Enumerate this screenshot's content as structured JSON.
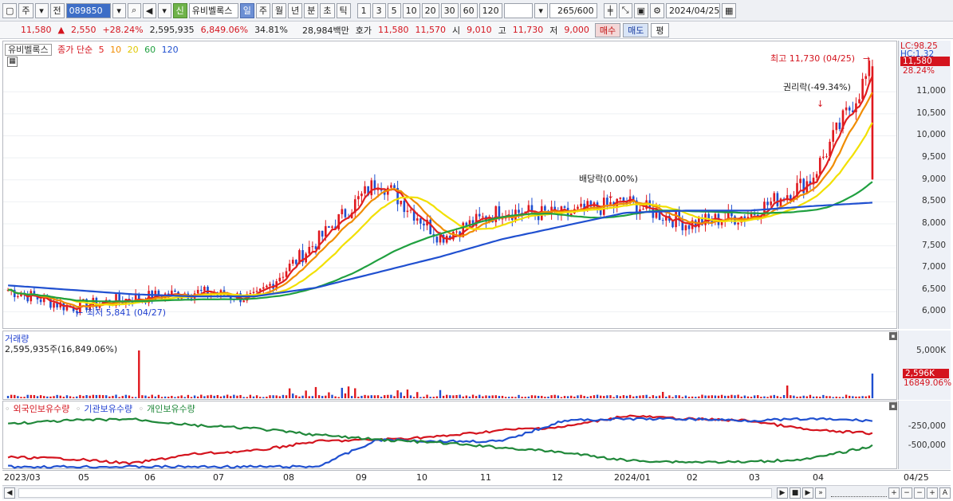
{
  "toolbar": {
    "type_label": "주",
    "prev_label": "전",
    "code_value": "089850",
    "stock_name": "유비벨록스",
    "credit_badge": "신",
    "periods": [
      "일",
      "주",
      "월",
      "년",
      "분",
      "초",
      "틱"
    ],
    "minute_options": [
      "1",
      "3",
      "5",
      "10",
      "20",
      "30",
      "60",
      "120"
    ],
    "count_value": "265",
    "count_total": "/600",
    "date_value": "2024/04/25"
  },
  "quote": {
    "price": "11,580",
    "change_arrow": "▲",
    "change": "2,550",
    "change_pct": "+28.24%",
    "volume": "2,595,935",
    "volume_ratio": "6,849.06%",
    "turnover": "34.81%",
    "trade_amount": "28,984백만",
    "ask_label": "호가",
    "ask_price": "11,580",
    "bid_price": "11,570",
    "open_label": "시",
    "open": "9,010",
    "high_label": "고",
    "high": "11,730",
    "low_label": "저",
    "low": "9,000",
    "buy_label": "매수",
    "sell_label": "매도",
    "eval_label": "평"
  },
  "price_panel": {
    "legend_name": "유비벨록스",
    "legend_ma": "종가 단순",
    "ma_periods": [
      "5",
      "10",
      "20",
      "60",
      "120"
    ],
    "ma_colors": [
      "#e02020",
      "#f08c00",
      "#f2e000",
      "#20a040",
      "#2050d0"
    ],
    "high_note": "최고 11,730 (04/25)",
    "low_note": "최저 5,841 (04/27)",
    "rights_note": "권리락(-49.34%)",
    "dividend_note": "배당락(0.00%)",
    "lc_label": "LC:98.25",
    "hc_label": "HC:1.32",
    "current_tag": "11,580",
    "current_pct": "28.24%",
    "y_ticks": [
      "11,000",
      "10,500",
      "10,000",
      "9,500",
      "9,000",
      "8,500",
      "8,000",
      "7,500",
      "7,000",
      "6,500",
      "6,000"
    ]
  },
  "volume_panel": {
    "title": "거래량",
    "summary": "2,595,935주(16,849.06%)",
    "y_tick": "5,000K",
    "current_tag": "2,596K",
    "current_pct": "16849.06%"
  },
  "holding_panel": {
    "legend_foreign": "외국인보유수량",
    "legend_inst": "기관보유수량",
    "legend_indiv": "개인보유수량",
    "y_ticks": [
      "-250,000",
      "-500,000"
    ]
  },
  "x_axis": {
    "labels": [
      "2023/03",
      "05",
      "06",
      "07",
      "08",
      "09",
      "10",
      "11",
      "12",
      "2024/01",
      "02",
      "03",
      "04"
    ],
    "right_label": "04/25"
  },
  "chart_data": {
    "type": "candlestick",
    "title": "유비벨록스",
    "x": [
      "2023/03",
      "2023/04",
      "2023/05",
      "2023/06",
      "2023/07",
      "2023/08",
      "2023/09",
      "2023/10",
      "2023/11",
      "2023/12",
      "2024/01",
      "2024/02",
      "2024/03",
      "2024/04",
      "2024/04/25"
    ],
    "close_approx": [
      6500,
      6100,
      6300,
      6450,
      6300,
      7600,
      9000,
      7700,
      8300,
      8200,
      8500,
      8000,
      8200,
      9000,
      11580
    ],
    "ma120_approx": [
      6600,
      6500,
      6400,
      6350,
      6350,
      6550,
      6900,
      7250,
      7650,
      7950,
      8250,
      8300,
      8300,
      8400,
      8480
    ],
    "ylim": [
      5700,
      12000
    ],
    "high": 11730,
    "low": 5841,
    "events": [
      {
        "label": "권리락(-49.34%)",
        "date": "2024/04"
      },
      {
        "label": "배당락(0.00%)",
        "date": "2023/12"
      }
    ]
  }
}
